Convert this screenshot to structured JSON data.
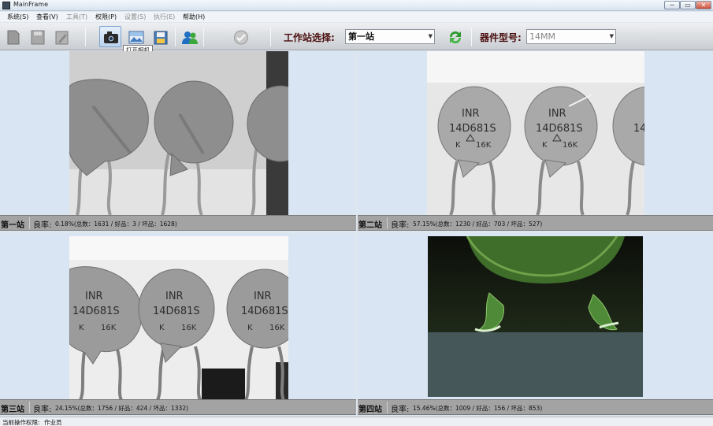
{
  "window": {
    "title": "MainFrame",
    "min": "─",
    "max": "▭",
    "close": "✕"
  },
  "menu": [
    {
      "label": "系统(S)",
      "enabled": true
    },
    {
      "label": "查看(V)",
      "enabled": true
    },
    {
      "label": "工具(T)",
      "enabled": false
    },
    {
      "label": "权限(P)",
      "enabled": true
    },
    {
      "label": "设置(S)",
      "enabled": false
    },
    {
      "label": "执行(E)",
      "enabled": false
    },
    {
      "label": "帮助(H)",
      "enabled": true
    }
  ],
  "toolbar": {
    "tooltip": "打开相机",
    "station_label": "工作站选择:",
    "station_value": "第一站",
    "model_label": "器件型号:",
    "model_value": "14MM"
  },
  "stations": [
    {
      "name": "第一站",
      "rate_label": "良率:",
      "rate": "0.18%(总数：1631 / 好品：3 / 坏品：1628)"
    },
    {
      "name": "第二站",
      "rate_label": "良率:",
      "rate": "57.15%(总数：1230 / 好品：703 / 坏品：527)"
    },
    {
      "name": "第三站",
      "rate_label": "良率:",
      "rate": "24.15%(总数：1756 / 好品：424 / 坏品：1332)"
    },
    {
      "name": "第四站",
      "rate_label": "良率:",
      "rate": "15.46%(总数：1009 / 好品：156 / 坏品：853)"
    }
  ],
  "varistor_marking": {
    "line1": "INR",
    "line2": "14D681S",
    "line3": "K",
    "line4": "16K"
  },
  "footer": {
    "label": "当前操作权限:",
    "value": "作业员"
  }
}
